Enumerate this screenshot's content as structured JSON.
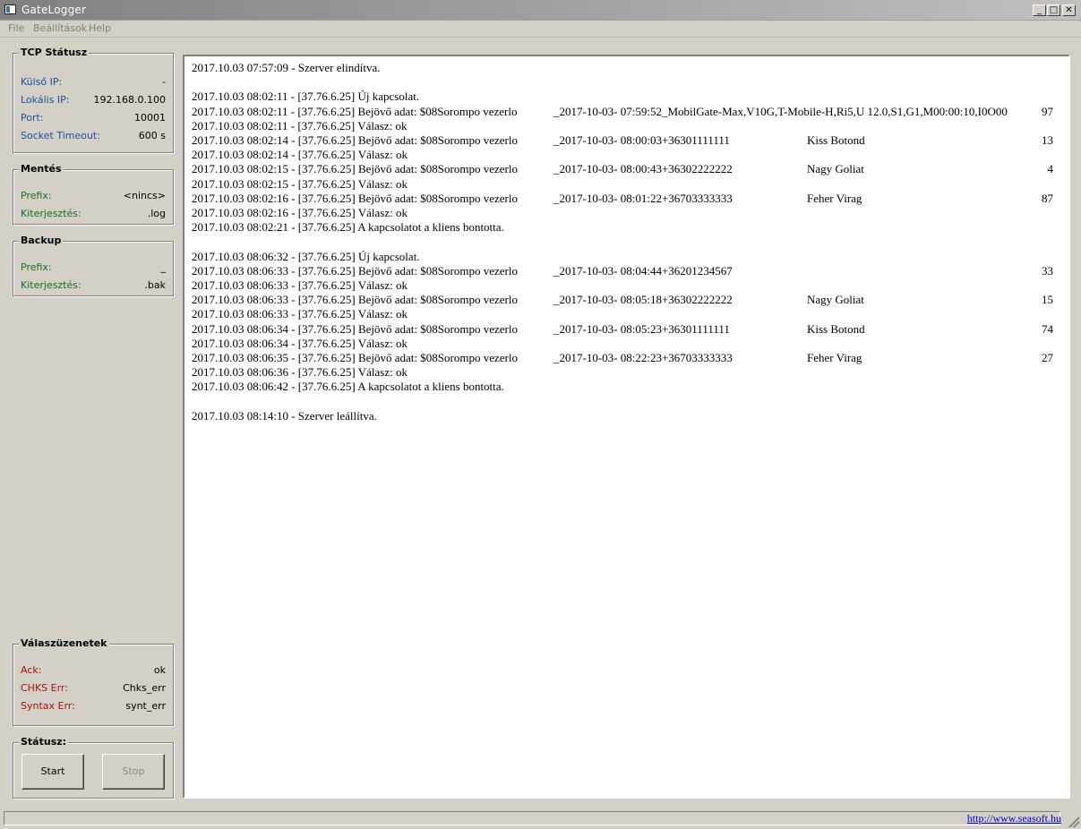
{
  "window": {
    "title": "GateLogger",
    "buttons": {
      "minimize": "_",
      "maximize": "□",
      "close": "✕"
    }
  },
  "menu": [
    "File",
    "Beállítások",
    "Help"
  ],
  "tcp_status": {
    "title": "TCP Státusz",
    "rows": [
      {
        "label": "Külső IP:",
        "value": "-"
      },
      {
        "label": "Lokális IP:",
        "value": "192.168.0.100"
      },
      {
        "label": "Port:",
        "value": "10001"
      },
      {
        "label": "Socket Timeout:",
        "value": "600 s"
      }
    ]
  },
  "mentes": {
    "title": "Mentés",
    "rows": [
      {
        "label": "Prefix:",
        "value": "<nincs>"
      },
      {
        "label": "Kiterjesztés:",
        "value": ".log"
      }
    ]
  },
  "backup": {
    "title": "Backup",
    "rows": [
      {
        "label": "Prefix:",
        "value": "_"
      },
      {
        "label": "Kiterjesztés:",
        "value": ".bak"
      }
    ]
  },
  "valaszuzenetek": {
    "title": "Válaszüzenetek",
    "rows": [
      {
        "label": "Ack:",
        "value": "ok"
      },
      {
        "label": "CHKS Err:",
        "value": "Chks_err"
      },
      {
        "label": "Syntax Err:",
        "value": "synt_err"
      }
    ]
  },
  "status": {
    "title": "Státusz:",
    "start_label": "Start",
    "stop_label": "Stop"
  },
  "log_lines": [
    {
      "text": "2017.10.03 07:57:09 - Szerver elindítva."
    },
    {
      "text": ""
    },
    {
      "text": "2017.10.03 08:02:11 - [37.76.6.25] Új kapcsolat."
    },
    {
      "text": "2017.10.03 08:02:11 - [37.76.6.25] Bejövő adat: $08Sorompo vezerlo",
      "c2": "_2017-10-03- 07:59:52_MobilGate-Max,V10G,T-Mobile-H,Ri5,U 12.0,S1,G1,M00:00:10,I0O00",
      "c4": "97"
    },
    {
      "text": "2017.10.03 08:02:11 - [37.76.6.25] Válasz: ok"
    },
    {
      "text": "2017.10.03 08:02:14 - [37.76.6.25] Bejövő adat: $08Sorompo vezerlo",
      "c2": "_2017-10-03- 08:00:03+36301111111",
      "c3": "Kiss Botond",
      "c4": "13"
    },
    {
      "text": "2017.10.03 08:02:14 - [37.76.6.25] Válasz: ok"
    },
    {
      "text": "2017.10.03 08:02:15 - [37.76.6.25] Bejövő adat: $08Sorompo vezerlo",
      "c2": "_2017-10-03- 08:00:43+36302222222",
      "c3": "Nagy Goliat",
      "c4": "4"
    },
    {
      "text": "2017.10.03 08:02:15 - [37.76.6.25] Válasz: ok"
    },
    {
      "text": "2017.10.03 08:02:16 - [37.76.6.25] Bejövő adat: $08Sorompo vezerlo",
      "c2": "_2017-10-03- 08:01:22+36703333333",
      "c3": "Feher Virag",
      "c4": "87"
    },
    {
      "text": "2017.10.03 08:02:16 - [37.76.6.25] Válasz: ok"
    },
    {
      "text": "2017.10.03 08:02:21 - [37.76.6.25] A kapcsolatot a kliens bontotta."
    },
    {
      "text": ""
    },
    {
      "text": "2017.10.03 08:06:32 - [37.76.6.25] Új kapcsolat."
    },
    {
      "text": "2017.10.03 08:06:33 - [37.76.6.25] Bejövő adat: $08Sorompo vezerlo",
      "c2": "_2017-10-03- 08:04:44+36201234567",
      "c4": "33"
    },
    {
      "text": "2017.10.03 08:06:33 - [37.76.6.25] Válasz: ok"
    },
    {
      "text": "2017.10.03 08:06:33 - [37.76.6.25] Bejövő adat: $08Sorompo vezerlo",
      "c2": "_2017-10-03- 08:05:18+36302222222",
      "c3": "Nagy Goliat",
      "c4": "15"
    },
    {
      "text": "2017.10.03 08:06:33 - [37.76.6.25] Válasz: ok"
    },
    {
      "text": "2017.10.03 08:06:34 - [37.76.6.25] Bejövő adat: $08Sorompo vezerlo",
      "c2": "_2017-10-03- 08:05:23+36301111111",
      "c3": "Kiss Botond",
      "c4": "74"
    },
    {
      "text": "2017.10.03 08:06:34 - [37.76.6.25] Válasz: ok"
    },
    {
      "text": "2017.10.03 08:06:35 - [37.76.6.25] Bejövő adat: $08Sorompo vezerlo",
      "c2": "_2017-10-03- 08:22:23+36703333333",
      "c3": "Feher Virag",
      "c4": "27"
    },
    {
      "text": "2017.10.03 08:06:36 - [37.76.6.25] Válasz: ok"
    },
    {
      "text": "2017.10.03 08:06:42 - [37.76.6.25] A kapcsolatot a kliens bontotta."
    },
    {
      "text": ""
    },
    {
      "text": "2017.10.03 08:14:10 - Szerver leállítva."
    }
  ],
  "statusbar": {
    "link": "http://www.seasoft.hu"
  }
}
